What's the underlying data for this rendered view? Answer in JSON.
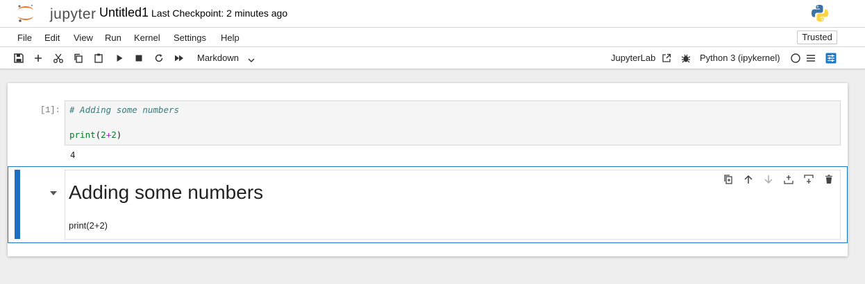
{
  "header": {
    "logo_text": "jupyter",
    "notebook_title": "Untitled1",
    "checkpoint_text": "Last Checkpoint: 2 minutes ago"
  },
  "menu": {
    "items": [
      "File",
      "Edit",
      "View",
      "Run",
      "Kernel",
      "Settings",
      "Help"
    ],
    "trusted_label": "Trusted"
  },
  "toolbar": {
    "icons": [
      "save-icon",
      "add-cell-icon",
      "cut-icon",
      "copy-icon",
      "paste-icon",
      "run-icon",
      "stop-icon",
      "restart-icon",
      "fast-forward-icon"
    ],
    "cell_type": "Markdown",
    "jupyterlab_label": "JupyterLab",
    "kernel_name": "Python 3 (ipykernel)"
  },
  "cells": {
    "code": {
      "prompt": "[1]:",
      "comment": "# Adding some numbers",
      "line_fn": "print",
      "line_open": "(",
      "line_a": "2",
      "line_op": "+",
      "line_b": "2",
      "line_close": ")",
      "output": "4"
    },
    "markdown": {
      "heading": "Adding some numbers",
      "text": "print(2+2)"
    }
  },
  "colors": {
    "accent": "#1e6fc2",
    "jupyter_orange": "#f37726"
  }
}
